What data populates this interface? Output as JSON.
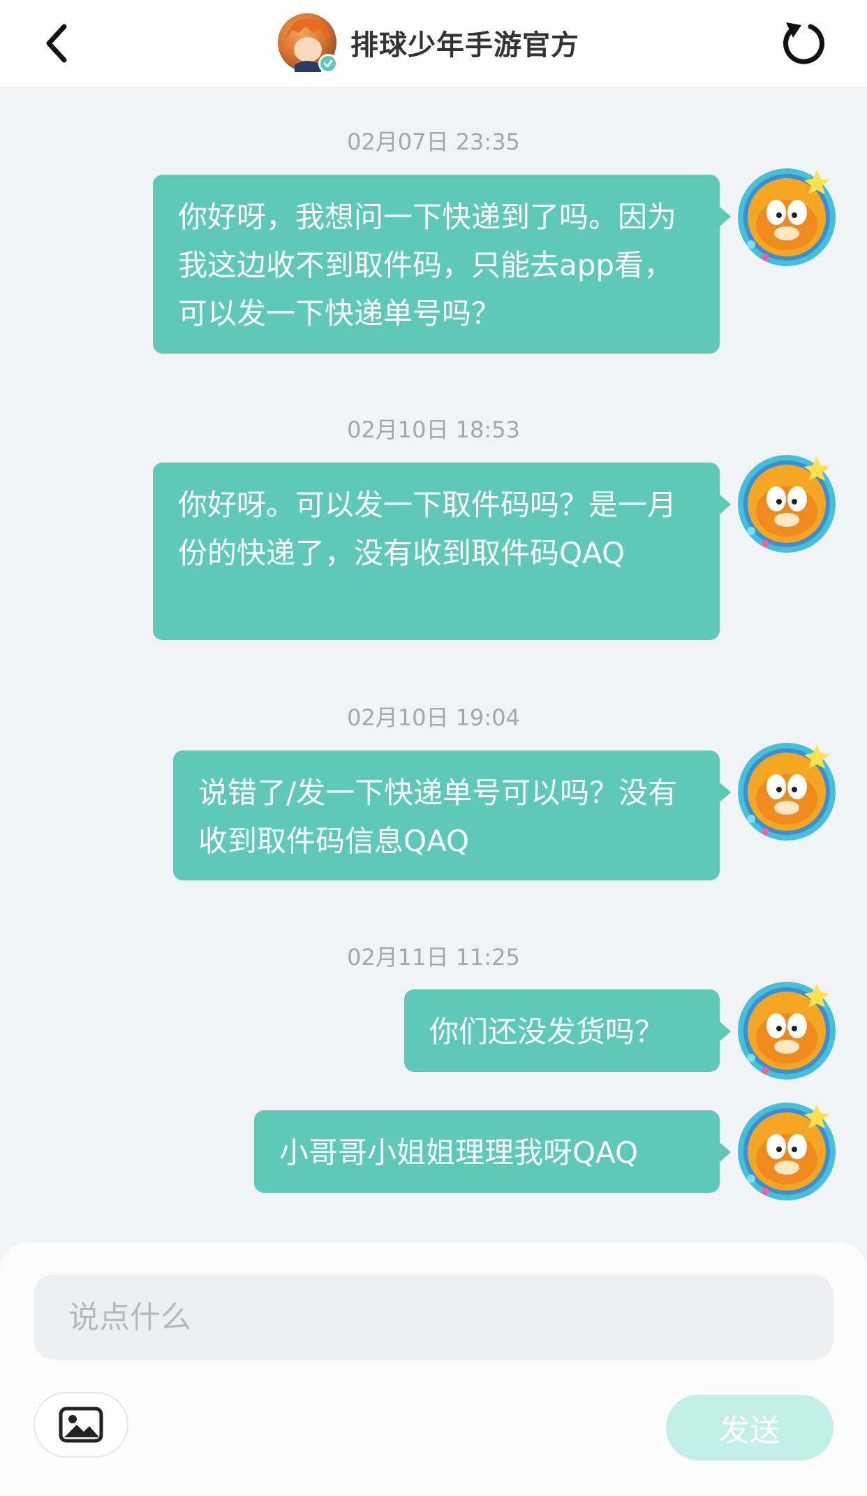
{
  "header": {
    "back_icon": "chevron-left-icon",
    "title": "排球少年手游官方",
    "verified_icon": "check-badge-icon",
    "refresh_icon": "refresh-icon"
  },
  "messages": [
    {
      "timestamp": "02月07日 23:35",
      "text": "你好呀，我想问一下快递到了吗。因为我这边收不到取件码，只能去app看，可以发一下快递单号吗？"
    },
    {
      "timestamp": "02月10日 18:53",
      "text": "你好呀。可以发一下取件码吗？是一月份的快递了，没有收到取件码QAQ"
    },
    {
      "timestamp": "02月10日 19:04",
      "text": "说错了/发一下快递单号可以吗？没有收到取件码信息QAQ"
    },
    {
      "timestamp": "02月11日 11:25",
      "text": "你们还没发货吗？"
    },
    {
      "timestamp": "",
      "text": "小哥哥小姐姐理理我呀QAQ"
    }
  ],
  "composer": {
    "placeholder": "说点什么",
    "image_icon": "image-icon",
    "send_label": "发送"
  },
  "colors": {
    "accent": "#5fc9b7",
    "send_disabled": "#c2efe7",
    "background": "#f2f3f5"
  }
}
